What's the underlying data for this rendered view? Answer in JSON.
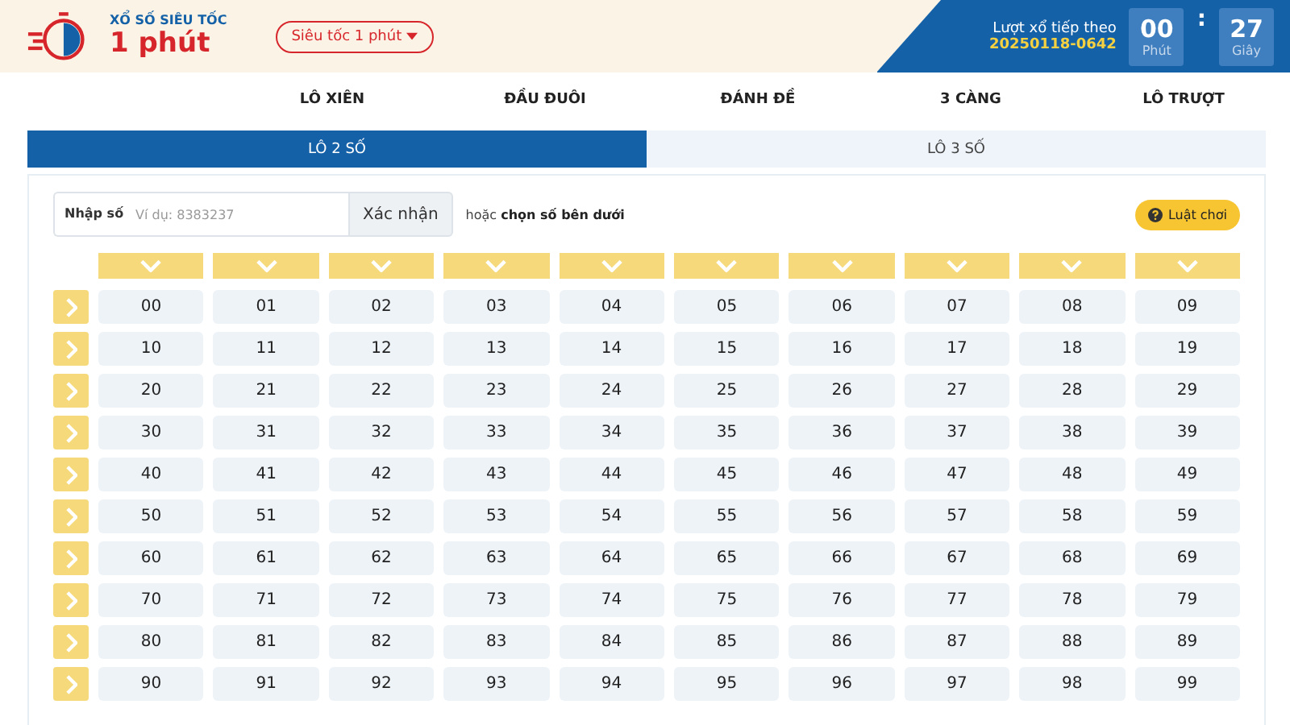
{
  "header": {
    "subtitle": "XỔ SỐ SIÊU TỐC",
    "title": "1 phút",
    "game_select": "Siêu tốc 1 phút",
    "next_draw_label": "Lượt xổ tiếp theo",
    "next_draw_id": "20250118-0642",
    "countdown": [
      {
        "value": "00",
        "unit": "Phút"
      },
      {
        "value": "27",
        "unit": "Giây"
      }
    ],
    "separator": ":"
  },
  "tabs": [
    {
      "label": "LÔ XIÊN",
      "selected": false
    },
    {
      "label": "ĐẦU ĐUÔI",
      "selected": false
    },
    {
      "label": "ĐÁNH ĐỀ",
      "selected": false
    },
    {
      "label": "3 CÀNG",
      "selected": false
    },
    {
      "label": "LÔ TRƯỢT",
      "selected": false
    }
  ],
  "subtabs": [
    {
      "label": "LÔ 2 SỐ",
      "selected": true
    },
    {
      "label": "LÔ 3 SỐ",
      "selected": false
    }
  ],
  "entry": {
    "label": "Nhập số",
    "placeholder": "Ví dụ: 8383237",
    "button": "Xác nhận",
    "hint": "hoặc **chọn số bên dưới**",
    "rules_button": "Luật chơi"
  },
  "grid": [
    [
      "00",
      "01",
      "02",
      "03",
      "04",
      "05",
      "06",
      "07",
      "08",
      "09"
    ],
    [
      "10",
      "11",
      "12",
      "13",
      "14",
      "15",
      "16",
      "17",
      "18",
      "19"
    ],
    [
      "20",
      "21",
      "22",
      "23",
      "24",
      "25",
      "26",
      "27",
      "28",
      "29"
    ],
    [
      "30",
      "31",
      "32",
      "33",
      "34",
      "35",
      "36",
      "37",
      "38",
      "39"
    ],
    [
      "40",
      "41",
      "42",
      "43",
      "44",
      "45",
      "46",
      "47",
      "48",
      "49"
    ],
    [
      "50",
      "51",
      "52",
      "53",
      "54",
      "55",
      "56",
      "57",
      "58",
      "59"
    ],
    [
      "60",
      "61",
      "62",
      "63",
      "64",
      "65",
      "66",
      "67",
      "68",
      "69"
    ],
    [
      "70",
      "71",
      "72",
      "73",
      "74",
      "75",
      "76",
      "77",
      "78",
      "79"
    ],
    [
      "80",
      "81",
      "82",
      "83",
      "84",
      "85",
      "86",
      "87",
      "88",
      "89"
    ],
    [
      "90",
      "91",
      "92",
      "93",
      "94",
      "95",
      "96",
      "97",
      "98",
      "99"
    ]
  ]
}
